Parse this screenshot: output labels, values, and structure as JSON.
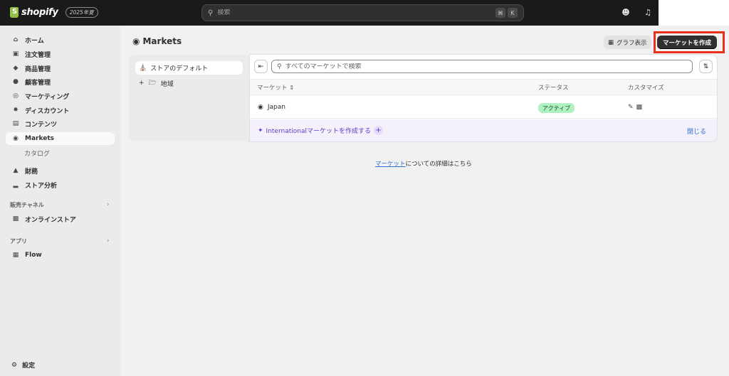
{
  "topbar": {
    "brand": "shopify",
    "edition": "2025年夏",
    "search_placeholder": "検索",
    "shortcut_keys": [
      "⌘",
      "K"
    ]
  },
  "sidebar": {
    "items": [
      {
        "label": "ホーム",
        "icon": "home-icon"
      },
      {
        "label": "注文管理",
        "icon": "inbox-icon"
      },
      {
        "label": "商品管理",
        "icon": "tag-icon"
      },
      {
        "label": "顧客管理",
        "icon": "person-icon"
      },
      {
        "label": "マーケティング",
        "icon": "target-icon"
      },
      {
        "label": "ディスカウント",
        "icon": "discount-icon"
      },
      {
        "label": "コンテンツ",
        "icon": "content-icon"
      },
      {
        "label": "Markets",
        "icon": "globe-icon"
      }
    ],
    "sub_item": "カタログ",
    "items2": [
      {
        "label": "財務",
        "icon": "bank-icon"
      },
      {
        "label": "ストア分析",
        "icon": "bar-chart-icon"
      }
    ],
    "sales_channels_label": "販売チャネル",
    "online_store": "オンラインストア",
    "apps_label": "アプリ",
    "flow": "Flow",
    "settings": "設定"
  },
  "page": {
    "title": "Markets",
    "graph_button": "グラフ表示",
    "create_button": "マーケットを作成"
  },
  "tree": {
    "default_label": "ストアのデフォルト",
    "region_label": "地域"
  },
  "table": {
    "search_placeholder": "すべてのマーケットで検索",
    "col_market": "マーケット",
    "col_status": "ステータス",
    "col_customize": "カスタマイズ",
    "rows": [
      {
        "name": "Japan",
        "status": "アクティブ"
      }
    ],
    "international_link": "Internationalマーケットを作成する",
    "close_label": "閉じる"
  },
  "footer": {
    "link": "マーケット",
    "text": "についての詳細はこちら"
  }
}
